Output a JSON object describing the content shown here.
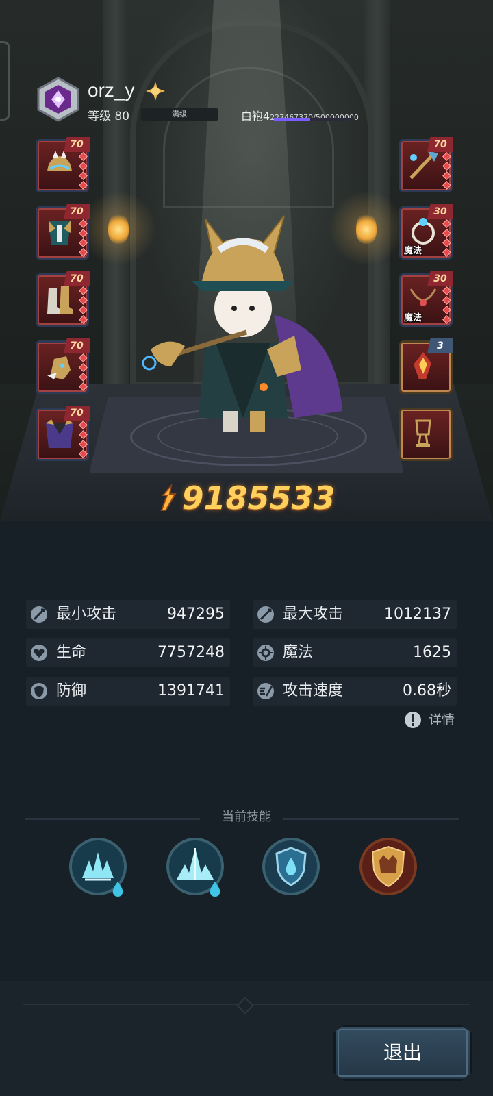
{
  "player": {
    "name": "orz_y",
    "level_label": "等级 80",
    "max_level_text": "满级",
    "title_text": "白袍4",
    "exp_text": "227467370/500000000",
    "exp_fraction": 0.455
  },
  "equipment": {
    "left": [
      {
        "name": "helmet",
        "level": "70"
      },
      {
        "name": "armor",
        "level": "70"
      },
      {
        "name": "boots",
        "level": "70"
      },
      {
        "name": "gloves",
        "level": "70"
      },
      {
        "name": "cloak",
        "level": "70"
      }
    ],
    "right": [
      {
        "name": "weapon",
        "level": "70",
        "tag": ""
      },
      {
        "name": "ring",
        "level": "30",
        "tag": "魔法"
      },
      {
        "name": "necklace",
        "level": "30",
        "tag": "魔法"
      },
      {
        "name": "gem",
        "level": "3",
        "tag": ""
      },
      {
        "name": "trophy",
        "level": "",
        "tag": ""
      }
    ]
  },
  "power": "9185533",
  "stats": [
    {
      "label": "最小攻击",
      "value": "947295",
      "icon": "sword-icon"
    },
    {
      "label": "最大攻击",
      "value": "1012137",
      "icon": "sword-icon"
    },
    {
      "label": "生命",
      "value": "7757248",
      "icon": "heart-icon"
    },
    {
      "label": "魔法",
      "value": "1625",
      "icon": "magic-icon"
    },
    {
      "label": "防御",
      "value": "1391741",
      "icon": "shield-icon"
    },
    {
      "label": "攻击速度",
      "value": "0.68秒",
      "icon": "speed-icon"
    }
  ],
  "details_label": "详情",
  "skills_title": "当前技能",
  "skills": [
    {
      "name": "ice-crystal-skill"
    },
    {
      "name": "ice-spike-skill"
    },
    {
      "name": "water-shield-skill"
    },
    {
      "name": "golden-guard-skill"
    }
  ],
  "exit_label": "退出",
  "colors": {
    "power": "#ffd15c",
    "background": "#182027",
    "stat_row": "#1f2831",
    "exp_fill": "#7a5cff"
  }
}
